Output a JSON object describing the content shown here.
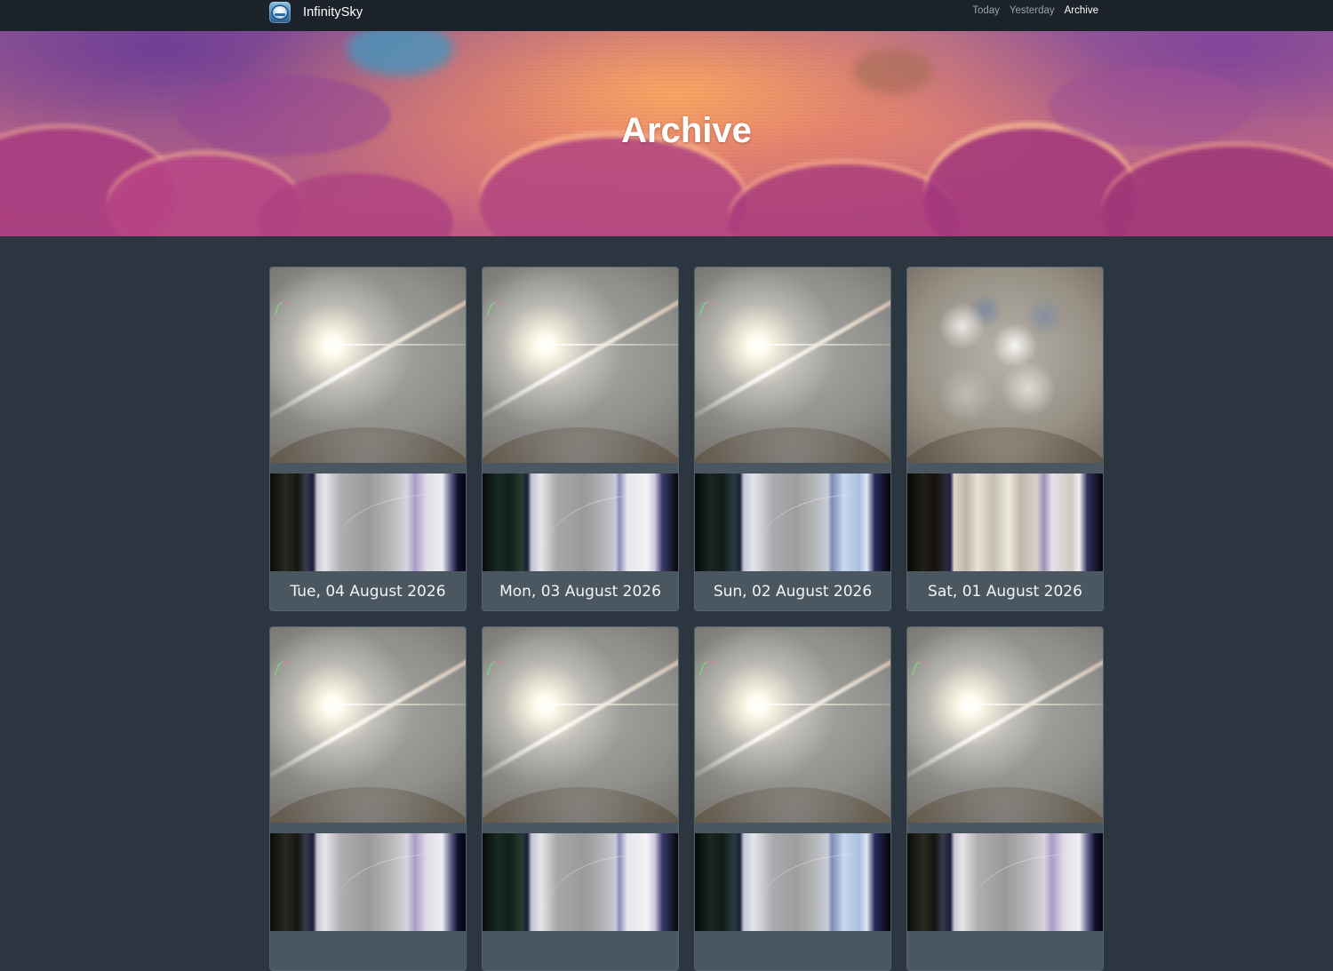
{
  "navbar": {
    "brand_name": "InfinitySky",
    "logo_icon": "sky-camera-logo-icon",
    "links": [
      {
        "label": "Today",
        "active": false
      },
      {
        "label": "Yesterday",
        "active": false
      },
      {
        "label": "Archive",
        "active": true
      }
    ]
  },
  "hero": {
    "title": "Archive"
  },
  "archive": {
    "days": [
      {
        "date": "Tue, 04 August 2026",
        "photo": "sun",
        "keogram": 0
      },
      {
        "date": "Mon, 03 August 2026",
        "photo": "sun",
        "keogram": 1
      },
      {
        "date": "Sun, 02 August 2026",
        "photo": "sun",
        "keogram": 2
      },
      {
        "date": "Sat, 01 August 2026",
        "photo": "cloudy",
        "keogram": 3
      },
      {
        "date": "",
        "photo": "sun",
        "keogram": 0
      },
      {
        "date": "",
        "photo": "sun",
        "keogram": 1
      },
      {
        "date": "",
        "photo": "sun",
        "keogram": 2
      },
      {
        "date": "",
        "photo": "sun",
        "keogram": 0
      }
    ]
  },
  "colors": {
    "navbar_bg": "#1b2229",
    "page_bg": "#2b3640",
    "card_bg": "#4a5660",
    "nav_link": "#9aa3ab",
    "nav_link_active": "#ffffff"
  }
}
